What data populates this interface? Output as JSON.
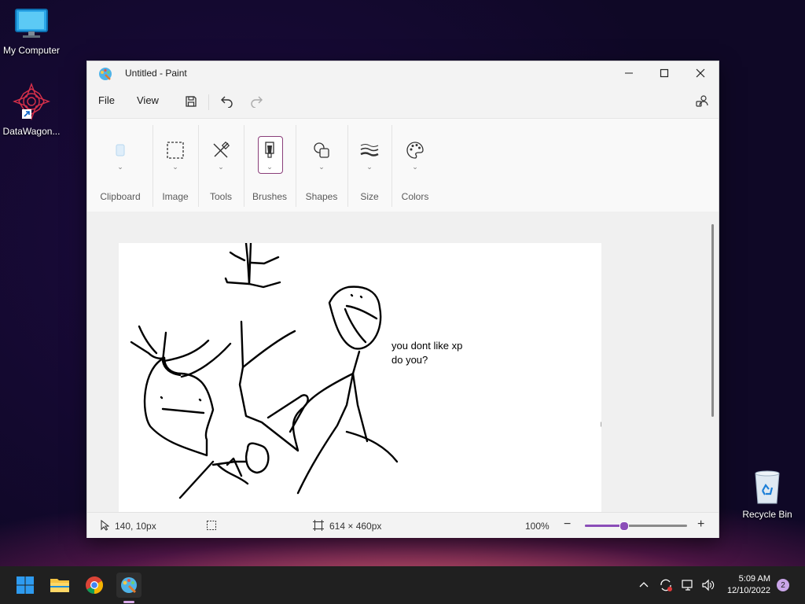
{
  "desktop": {
    "icons": [
      {
        "label": "My Computer"
      },
      {
        "label": "DataWagon..."
      },
      {
        "label": "Recycle Bin"
      }
    ]
  },
  "window": {
    "title": "Untitled - Paint",
    "menu": {
      "file": "File",
      "view": "View"
    },
    "ribbon": {
      "groups": [
        "Clipboard",
        "Image",
        "Tools",
        "Brushes",
        "Shapes",
        "Size",
        "Colors"
      ]
    },
    "canvas": {
      "text_line1": "you dont like xp",
      "text_line2": "do you?"
    },
    "status": {
      "cursor_pos": "140, 10px",
      "canvas_size": "614 × 460px",
      "zoom": "100%",
      "zoom_level": 0.38
    }
  },
  "taskbar": {
    "clock_time": "5:09 AM",
    "clock_date": "12/10/2022",
    "notification_count": "2"
  },
  "colors": {
    "accent": "#8b4db8",
    "taskbar": "#202020"
  }
}
